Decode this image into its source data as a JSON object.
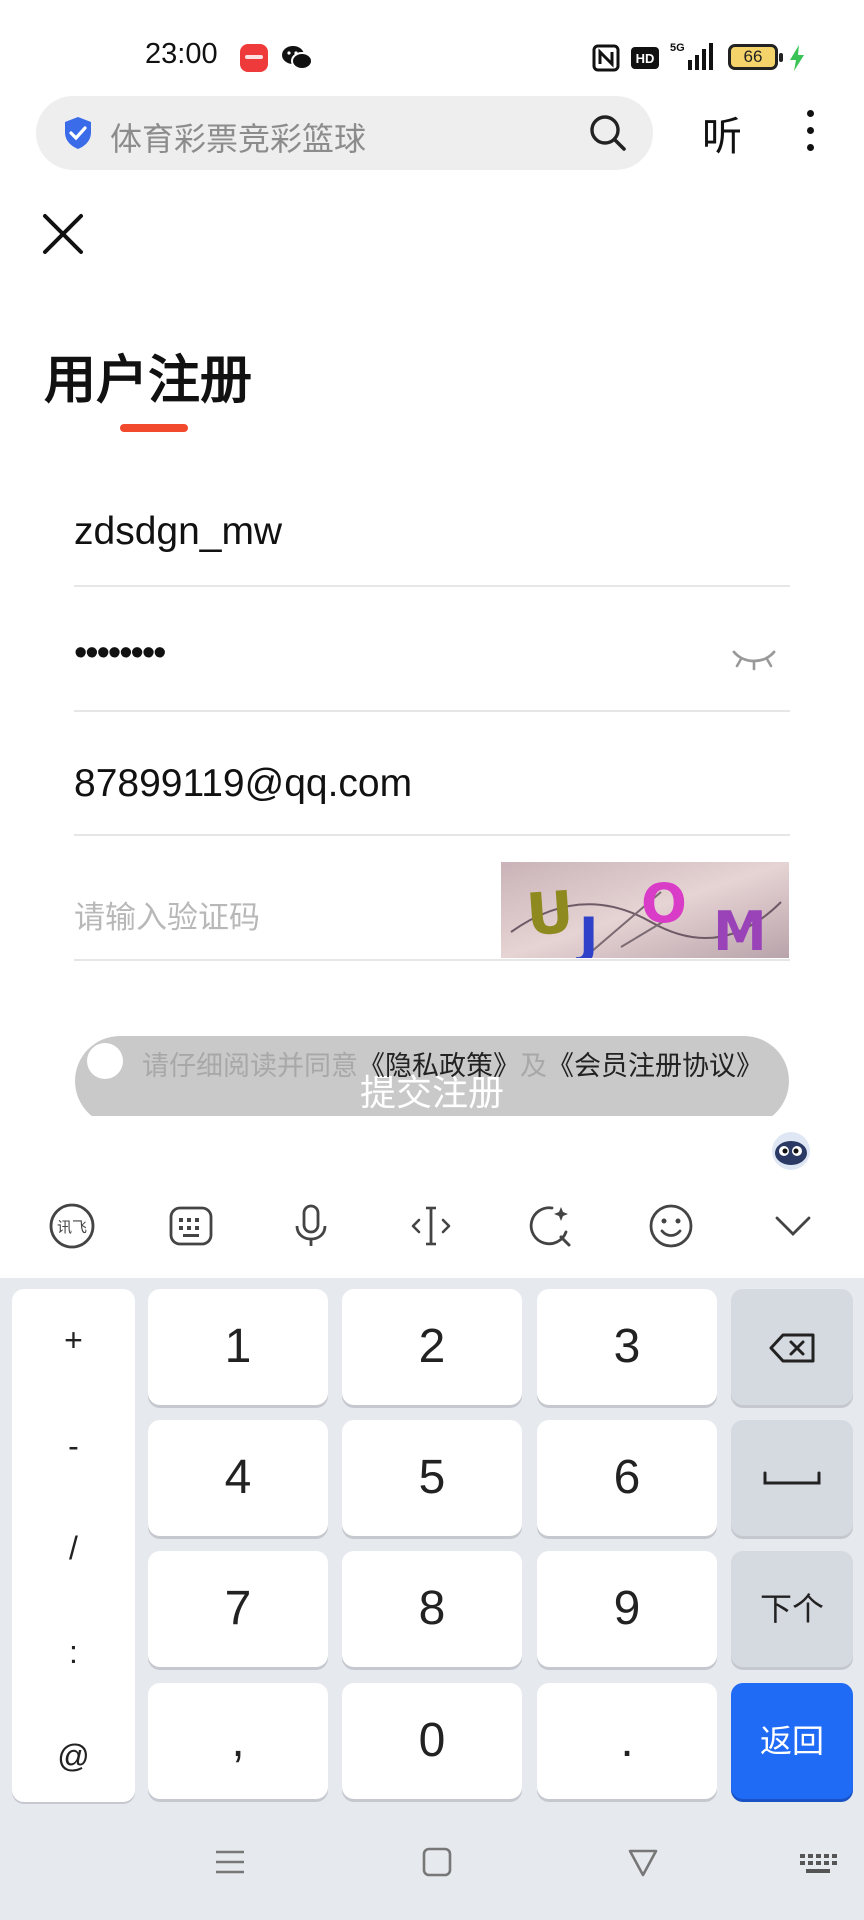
{
  "status_bar": {
    "time": "23:00",
    "battery": "66",
    "icons": [
      "red-app-icon",
      "wechat-icon",
      "nfc-icon",
      "hd-icon",
      "5g-signal-icon",
      "battery-icon",
      "charging-icon"
    ]
  },
  "browser": {
    "search_text": "体育彩票竞彩篮球",
    "listen_label": "听",
    "icons": [
      "shield-check-icon",
      "search-icon",
      "more-icon"
    ]
  },
  "form": {
    "title": "用户注册",
    "accent_color": "#f24a2c",
    "username": "zdsdgn_mw",
    "password_masked": "••••••••",
    "email": "87899119@qq.com",
    "captcha_placeholder": "请输入验证码",
    "captcha_code": "UJOM",
    "agree_prefix": "请仔细阅读并同意",
    "privacy_link": "《隐私政策》",
    "agree_and": "及",
    "terms_link": "《会员注册协议》",
    "submit_label": "提交注册"
  },
  "keyboard": {
    "symbols": [
      "+",
      "-",
      "/",
      ":",
      "@"
    ],
    "rows": [
      [
        "1",
        "2",
        "3"
      ],
      [
        "4",
        "5",
        "6"
      ],
      [
        "7",
        "8",
        "9"
      ],
      [
        ",",
        "0",
        "."
      ]
    ],
    "next_label": "下个",
    "return_label": "返回",
    "accent_color": "#1f6bf5"
  }
}
